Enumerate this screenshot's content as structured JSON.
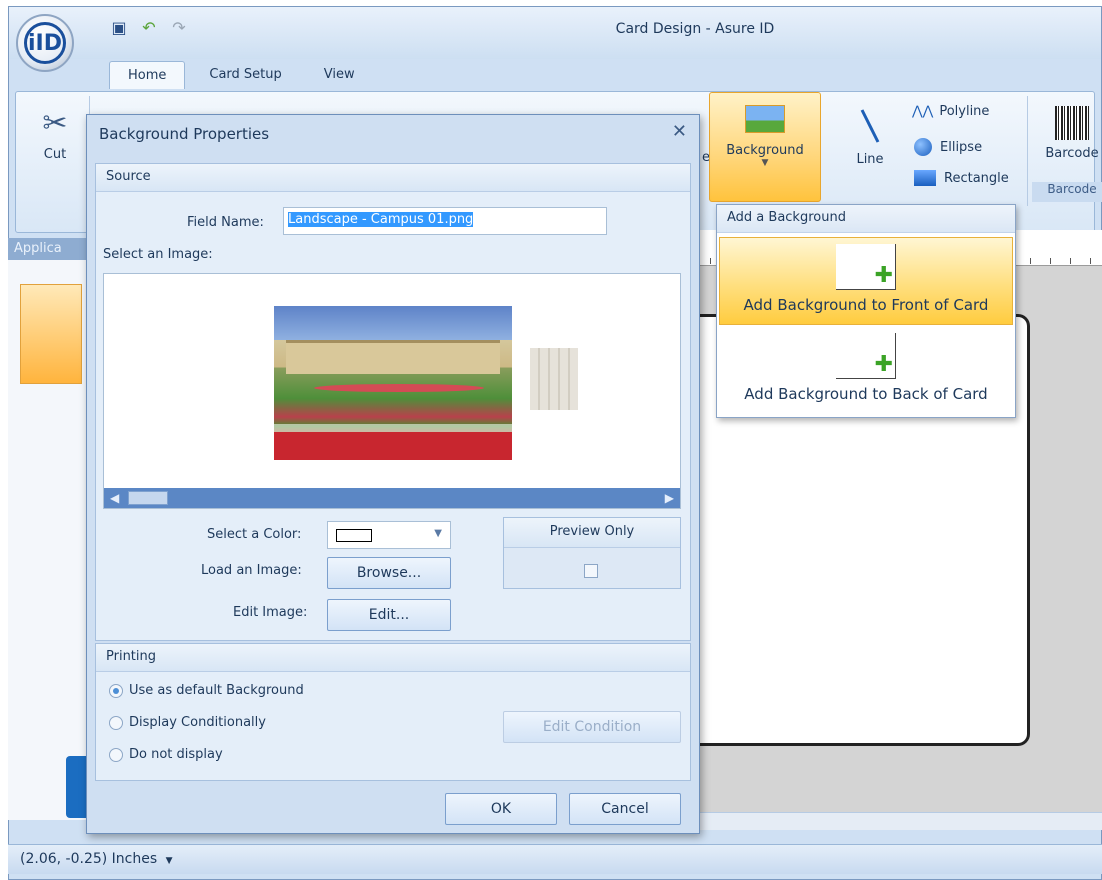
{
  "app": {
    "title": "Card Design - Asure ID",
    "logo_text": "iID",
    "qat_icons": [
      "save-icon",
      "undo-icon",
      "redo-icon"
    ]
  },
  "ribbon": {
    "tabs": [
      "Home",
      "Card Setup",
      "View"
    ],
    "active_tab": "Home",
    "cut_label": "Cut",
    "background_label": "Background",
    "line_label": "Line",
    "polyline_label": "Polyline",
    "ellipse_label": "Ellipse",
    "rectangle_label": "Rectangle",
    "barcode_label": "Barcode",
    "barcode_group_label": "Barcode",
    "partial_label": "e"
  },
  "sidebar": {
    "tab_label": "Applica"
  },
  "background_menu": {
    "header": "Add a Background",
    "front_label": "Add Background to Front of Card",
    "back_label": "Add Background to Back of Card"
  },
  "dialog": {
    "title": "Background Properties",
    "source": {
      "header": "Source",
      "field_name_label": "Field Name:",
      "field_name_value": "Landscape - Campus 01.png",
      "select_image_label": "Select an Image:",
      "select_color_label": "Select a Color:",
      "load_image_label": "Load an Image:",
      "browse_label": "Browse...",
      "edit_image_label": "Edit Image:",
      "edit_label": "Edit...",
      "preview_only_label": "Preview Only",
      "preview_only_checked": false
    },
    "printing": {
      "header": "Printing",
      "options": [
        "Use as default Background",
        "Display Conditionally",
        "Do not display"
      ],
      "selected": "Use as default Background",
      "edit_condition_label": "Edit Condition"
    },
    "ok_label": "OK",
    "cancel_label": "Cancel"
  },
  "status": {
    "coords": "(2.06, -0.25) Inches"
  },
  "colors": {
    "accent": "#ffc33d",
    "selection": "#3399ff",
    "chrome": "#cfdff2"
  }
}
